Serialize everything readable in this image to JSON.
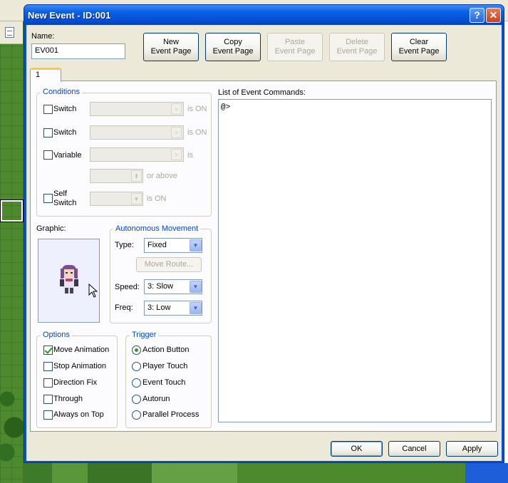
{
  "window": {
    "title": "New Event - ID:001",
    "help_label": "?",
    "close_label": "✕"
  },
  "name_field": {
    "label": "Name:",
    "value": "EV001"
  },
  "page_buttons": [
    {
      "line1": "New",
      "line2": "Event Page",
      "enabled": true
    },
    {
      "line1": "Copy",
      "line2": "Event Page",
      "enabled": true
    },
    {
      "line1": "Paste",
      "line2": "Event Page",
      "enabled": false
    },
    {
      "line1": "Delete",
      "line2": "Event Page",
      "enabled": false
    },
    {
      "line1": "Clear",
      "line2": "Event Page",
      "enabled": true
    }
  ],
  "tabs": [
    {
      "label": "1",
      "selected": true
    }
  ],
  "conditions": {
    "title": "Conditions",
    "switch1": {
      "label": "Switch",
      "checked": false,
      "suffix": "is ON"
    },
    "switch2": {
      "label": "Switch",
      "checked": false,
      "suffix": "is ON"
    },
    "variable": {
      "label": "Variable",
      "checked": false,
      "suffix": "is",
      "or_above": "or above"
    },
    "self_switch": {
      "label_line1": "Self",
      "label_line2": "Switch",
      "checked": false,
      "suffix": "is ON"
    }
  },
  "graphic": {
    "label": "Graphic:",
    "sprite": "character-sprite"
  },
  "autonomous": {
    "title": "Autonomous Movement",
    "type_label": "Type:",
    "type_value": "Fixed",
    "move_route_label": "Move Route...",
    "speed_label": "Speed:",
    "speed_value": "3: Slow",
    "freq_label": "Freq:",
    "freq_value": "3: Low"
  },
  "options": {
    "title": "Options",
    "items": [
      {
        "label": "Move Animation",
        "checked": true
      },
      {
        "label": "Stop Animation",
        "checked": false
      },
      {
        "label": "Direction Fix",
        "checked": false
      },
      {
        "label": "Through",
        "checked": false
      },
      {
        "label": "Always on Top",
        "checked": false
      }
    ]
  },
  "trigger": {
    "title": "Trigger",
    "items": [
      {
        "label": "Action Button",
        "selected": true
      },
      {
        "label": "Player Touch",
        "selected": false
      },
      {
        "label": "Event Touch",
        "selected": false
      },
      {
        "label": "Autorun",
        "selected": false
      },
      {
        "label": "Parallel Process",
        "selected": false
      }
    ]
  },
  "commands": {
    "label": "List of Event Commands:",
    "lines": [
      "@>"
    ]
  },
  "footer": {
    "ok": "OK",
    "cancel": "Cancel",
    "apply": "Apply"
  },
  "colors": {
    "titlebar": "#0b5fe3",
    "accent_group_title": "#0046d5",
    "check_green": "#21a121"
  }
}
